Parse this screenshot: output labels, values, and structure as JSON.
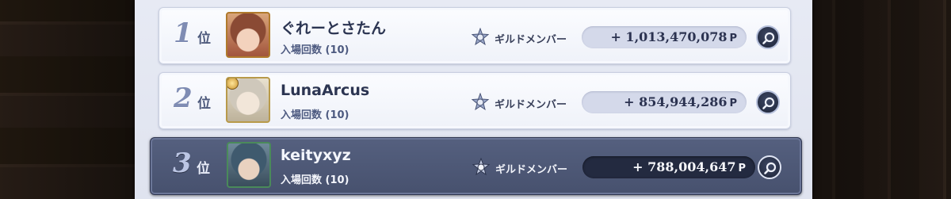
{
  "ranking": {
    "rows": [
      {
        "rank": "1",
        "rank_suffix": "位",
        "name": "ぐれーとさたん",
        "entries": "入場回数 (10)",
        "guild_label": "ギルドメンバー",
        "points": "+ 1,013,470,078",
        "points_unit": "P"
      },
      {
        "rank": "2",
        "rank_suffix": "位",
        "name": "LunaArcus",
        "entries": "入場回数 (10)",
        "guild_label": "ギルドメンバー",
        "points": "+ 854,944,286",
        "points_unit": "P"
      },
      {
        "rank": "3",
        "rank_suffix": "位",
        "name": "keityxyz",
        "entries": "入場回数 (10)",
        "guild_label": "ギルドメンバー",
        "points": "+ 788,004,647",
        "points_unit": "P",
        "selected": true
      }
    ]
  },
  "icons": {
    "guild": "guild-emblem-icon",
    "search": "magnifier-icon"
  },
  "colors": {
    "panel": "#e3e7f2",
    "selected_row": "#4d5775",
    "accent": "#7f8cb3"
  }
}
